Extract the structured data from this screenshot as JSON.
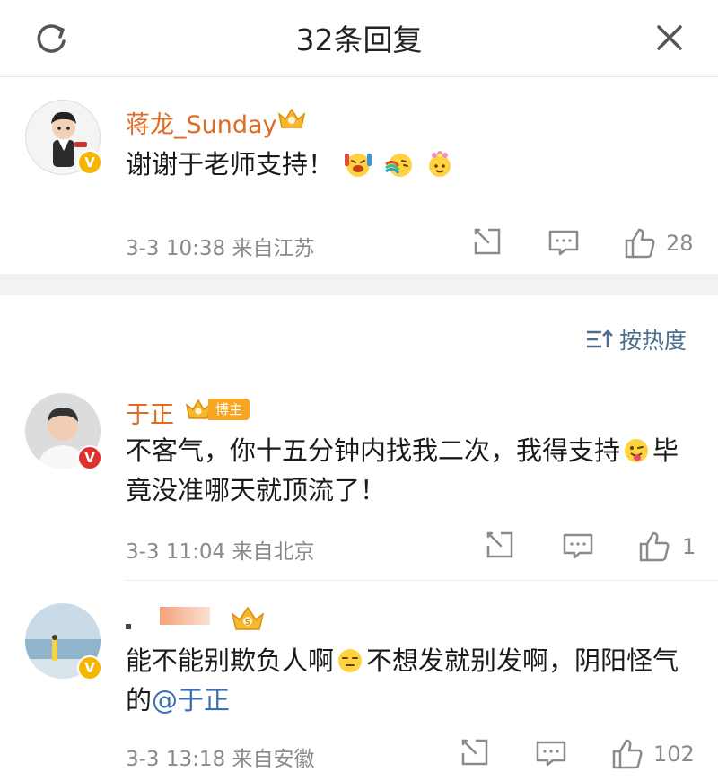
{
  "header": {
    "title": "32条回复",
    "refresh_icon": "refresh-icon",
    "close_icon": "close-icon"
  },
  "sort": {
    "label": "按热度",
    "icon": "sort-icon"
  },
  "comments": [
    {
      "username": "蒋龙_Sunday",
      "badge": "crown-badge",
      "verified": "gold",
      "text": "谢谢于老师支持！",
      "emojis": [
        "cheering-emoji",
        "rainbow-emoji",
        "flower-emoji"
      ],
      "date": "3-3 10:38",
      "location": "来自江苏",
      "likes": "28"
    },
    {
      "username": "于正",
      "badge_text": "博主",
      "verified": "red",
      "text_part1": "不客气，你十五分钟内找我二次，我得支持",
      "text_part2": "毕竟没准哪天就顶流了！",
      "emoji": "tongue-emoji",
      "date": "3-3 11:04",
      "location": "来自北京",
      "likes": "1"
    },
    {
      "username": "",
      "badge": "crown-badge",
      "verified": "gold",
      "text_part1": "能不能别欺负人啊",
      "text_part2": "不想发就别发啊，阴阳怪气的",
      "mention": "@于正",
      "emoji": "sleepy-emoji",
      "date": "3-3 13:18",
      "location": "来自安徽",
      "likes": "102"
    }
  ],
  "colors": {
    "username": "#e06b22",
    "mention": "#3d6fb3",
    "meta": "#8a8a8a",
    "sort": "#4b6e8f"
  }
}
